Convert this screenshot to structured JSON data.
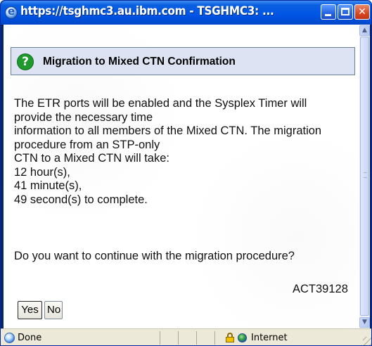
{
  "window": {
    "title": "https://tsghmc3.au.ibm.com - TSGHMC3: ..."
  },
  "dialog": {
    "header_title": "Migration to Mixed CTN Confirmation",
    "message_lines": [
      "The ETR ports will be enabled and the Sysplex Timer will",
      "provide the necessary time",
      "information to all members of the Mixed CTN. The migration",
      "procedure from an STP-only",
      "CTN to a Mixed CTN will take:",
      "12 hour(s),",
      "41 minute(s),",
      "49 second(s) to complete."
    ],
    "question": "Do you want to continue with the migration procedure?",
    "message_id": "ACT39128",
    "yes_label": "Yes",
    "no_label": "No"
  },
  "statusbar": {
    "status": "Done",
    "zone": "Internet"
  },
  "colors": {
    "titlebar": "#0055e5",
    "header_bg": "#dde3f3",
    "question_icon": "#1f9a2c",
    "statusbar_bg": "#ece9d8"
  },
  "icons": {
    "title": "ie-page-icon",
    "header": "question-icon",
    "status": "ie-page-icon",
    "security": "lock-icon",
    "zone": "globe-icon"
  }
}
